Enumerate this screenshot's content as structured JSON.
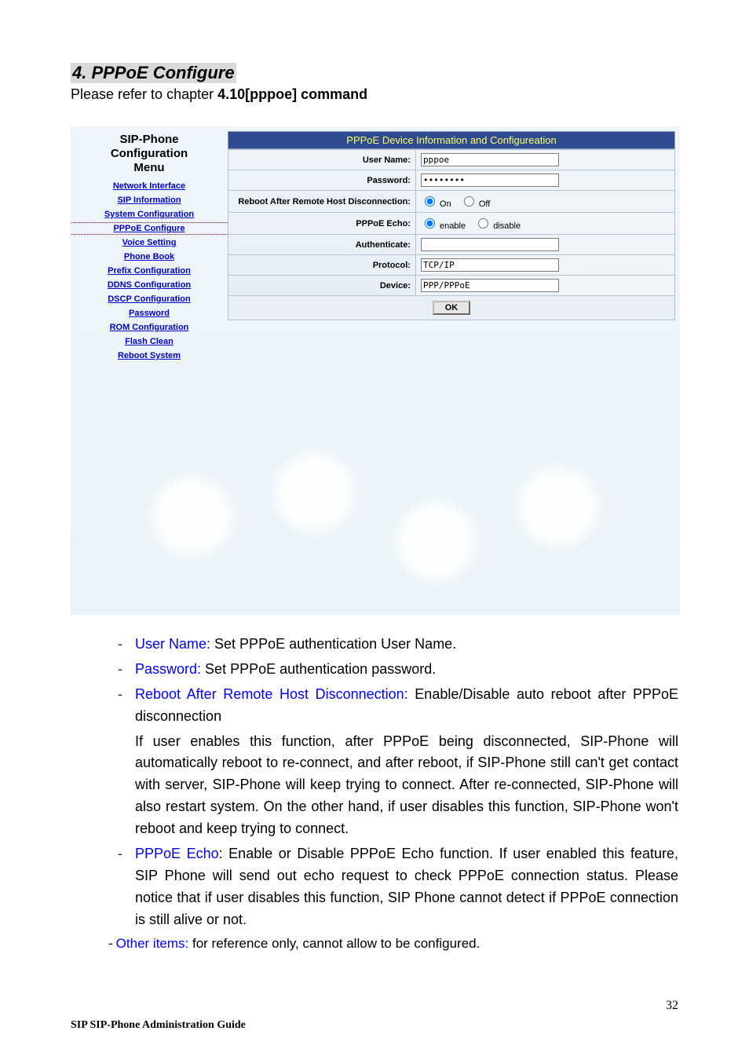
{
  "doc": {
    "section_heading": "4. PPPoE Configure",
    "intro_prefix": "Please refer to chapter ",
    "intro_bold": "4.10[pppoe] command",
    "page_number": "32",
    "footer": "SIP SIP-Phone    Administration Guide"
  },
  "sidebar": {
    "title_line1": "SIP-Phone",
    "title_line2": "Configuration",
    "title_line3": "Menu",
    "items": [
      "Network Interface",
      "SIP Information",
      "System Configuration",
      "PPPoE Configure",
      "Voice Setting",
      "Phone Book",
      "Prefix Configuration",
      "DDNS Configuration",
      "DSCP Configuration",
      "Password",
      "ROM Configuration",
      "Flash Clean",
      "Reboot System"
    ],
    "active_index": 3
  },
  "panel": {
    "title": "PPPoE Device Information and Configureation",
    "rows": {
      "user_name_label": "User Name:",
      "user_name_value": "pppoe",
      "password_label": "Password:",
      "password_value": "********",
      "reboot_label": "Reboot After Remote Host Disconnection:",
      "reboot_on": "On",
      "reboot_off": "Off",
      "echo_label": "PPPoE Echo:",
      "echo_enable": "enable",
      "echo_disable": "disable",
      "auth_label": "Authenticate:",
      "auth_value": "",
      "protocol_label": "Protocol:",
      "protocol_value": "TCP/IP",
      "device_label": "Device:",
      "device_value": "PPP/PPPoE"
    },
    "ok_label": "OK"
  },
  "desc": {
    "items": [
      {
        "term": "User Name:",
        "text": " Set PPPoE authentication User Name."
      },
      {
        "term": "Password:",
        "text": " Set PPPoE authentication password."
      },
      {
        "term": "Reboot After Remote Host Disconnection:",
        "text": " Enable/Disable auto reboot after PPPoE disconnection"
      }
    ],
    "reboot_para": "If user enables this function, after PPPoE being disconnected, SIP-Phone will automatically reboot to re-connect, and after reboot, if SIP-Phone still can't get contact with server, SIP-Phone will keep trying to connect. After re-connected, SIP-Phone will also restart system. On the other hand, if user disables this function, SIP-Phone won't reboot and keep trying to connect.",
    "echo_item": {
      "term": "PPPoE Echo",
      "text": ": Enable or Disable PPPoE Echo function. If user enabled this feature, SIP Phone will send out echo request to check PPPoE connection status. Please notice that if user disables this function, SIP Phone cannot detect if PPPoE connection is still alive or not."
    },
    "other_term": "Other items:",
    "other_text": " for reference only, cannot allow to be configured."
  }
}
